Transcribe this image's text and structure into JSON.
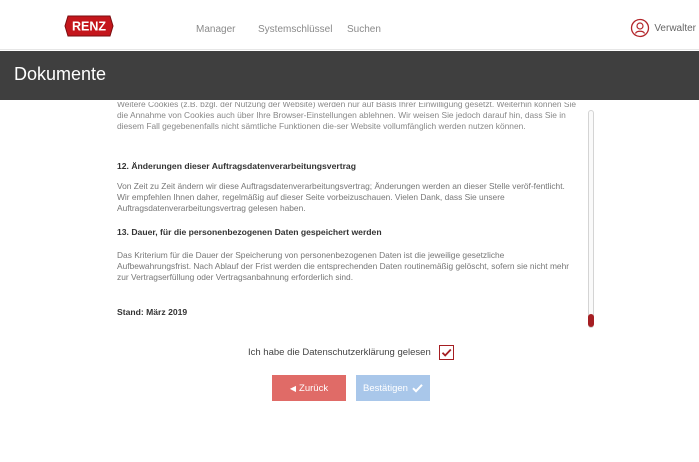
{
  "header": {
    "logo_text": "RENZ",
    "nav": [
      "Manager",
      "Systemschlüssel",
      "Suchen"
    ],
    "user_label": "Verwalter",
    "user_icon": "user-circle-icon"
  },
  "page": {
    "title": "Dokumente"
  },
  "document": {
    "paragraph_top": "Weitere Cookies (z.B. bzgl. der Nutzung der Website) werden nur auf Basis Ihrer Einwilligung gesetzt. Weiterhin können Sie die Annahme von Cookies auch über Ihre Browser-Einstellungen ablehnen. Wir weisen Sie jedoch darauf hin, dass Sie in diesem Fall gegebenenfalls nicht sämtliche Funktionen die-ser Website vollumfänglich werden nutzen können.",
    "heading_12": "12. Änderungen dieser Auftragsdatenverarbeitungsvertrag",
    "paragraph_12": "Von Zeit zu Zeit ändern wir diese Auftragsdatenverarbeitungsvertrag; Änderungen werden an dieser Stelle veröf-fentlicht. Wir empfehlen Ihnen daher, regelmäßig auf dieser Seite vorbeizuschauen. Vielen Dank, dass Sie unsere Auftragsdatenverarbeitungsvertrag gelesen haben.",
    "heading_13": "13. Dauer, für die personenbezogenen Daten gespeichert werden",
    "paragraph_13": "Das Kriterium für die Dauer der Speicherung von personenbezogenen Daten ist die jeweilige gesetzliche Aufbewahrungsfrist. Nach Ablauf der Frist werden die entsprechenden Daten routinemäßig gelöscht, sofern sie nicht mehr zur Vertragserfüllung oder Vertragsanbahnung erforderlich sind.",
    "stand": "Stand: März 2019"
  },
  "consent": {
    "label": "Ich habe die Datenschutzerklärung gelesen",
    "checked": true
  },
  "buttons": {
    "back_label": "Zurück",
    "back_icon": "caret-left-icon",
    "confirm_label": "Bestätigen",
    "confirm_icon": "checkmark-icon"
  },
  "colors": {
    "brand_red": "#a51e22",
    "titlebar": "#3f3f3f",
    "back_button": "#e06b67",
    "confirm_button": "#a9c7ea"
  }
}
